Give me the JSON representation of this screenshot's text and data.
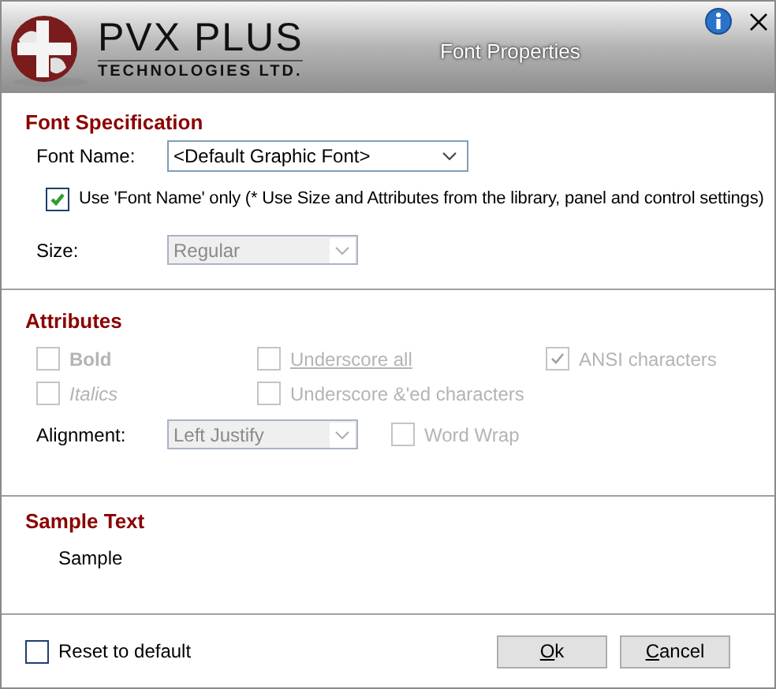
{
  "window": {
    "title": "Font Properties",
    "logo": {
      "name": "PVX PLUS",
      "tagline": "TECHNOLOGIES LTD."
    }
  },
  "font_specification": {
    "heading": "Font Specification",
    "font_name": {
      "label": "Font Name:",
      "value": "<Default Graphic Font>",
      "disabled": false
    },
    "name_only": {
      "label": "Use 'Font Name' only (* Use Size and Attributes from the library, panel and control settings)",
      "checked": true,
      "disabled": false
    },
    "size": {
      "label": "Size:",
      "value": "Regular",
      "disabled": true
    }
  },
  "attributes": {
    "heading": "Attributes",
    "options": [
      {
        "label": "Bold",
        "kind": "bold",
        "checked": false,
        "disabled": true
      },
      {
        "label": "Underscore all",
        "kind": "underline",
        "checked": false,
        "disabled": true
      },
      {
        "label": "ANSI characters",
        "kind": "plain",
        "checked": true,
        "disabled": true
      },
      {
        "label": "Italics",
        "kind": "italic",
        "checked": false,
        "disabled": true
      },
      {
        "label": "Underscore &'ed characters",
        "kind": "plain",
        "checked": false,
        "disabled": true
      }
    ],
    "alignment": {
      "label": "Alignment:",
      "value": "Left Justify",
      "disabled": true
    },
    "word_wrap": {
      "label": "Word Wrap",
      "checked": false,
      "disabled": true
    }
  },
  "sample": {
    "heading": "Sample Text",
    "text": "Sample"
  },
  "footer": {
    "reset": {
      "label": "Reset to default",
      "checked": false,
      "disabled": false
    },
    "buttons": [
      {
        "label": "Ok"
      },
      {
        "label": "Cancel"
      }
    ]
  }
}
